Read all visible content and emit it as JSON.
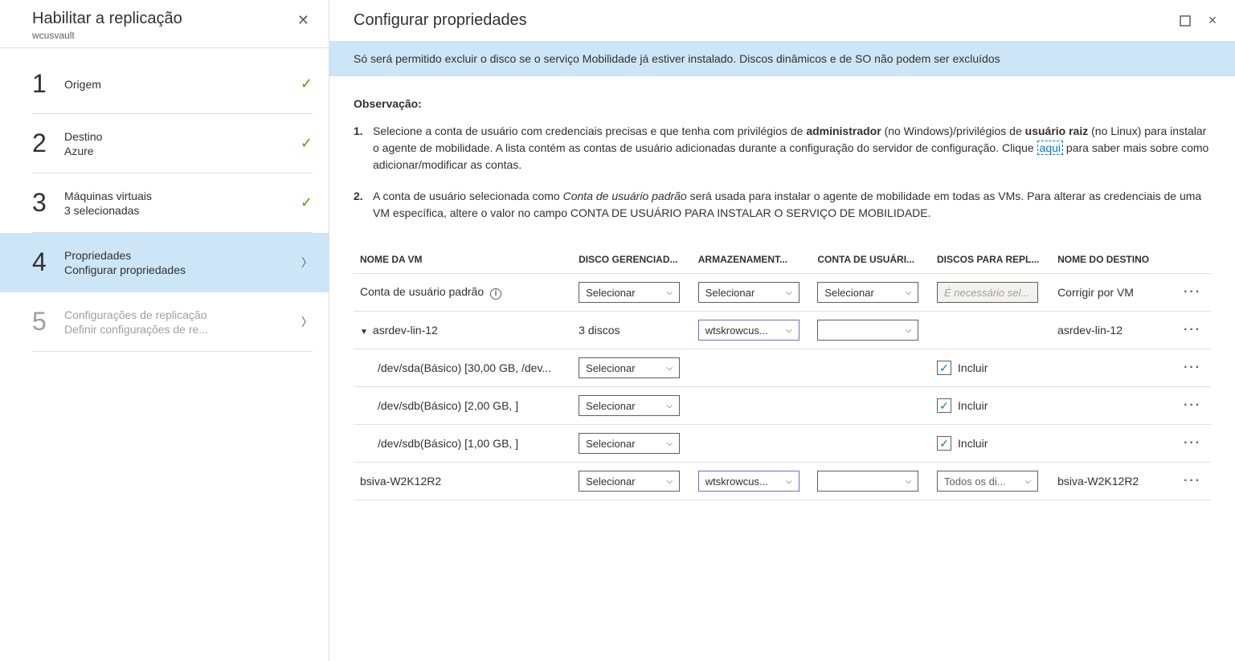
{
  "sidebar": {
    "title": "Habilitar a replicação",
    "subtitle": "wcusvault",
    "steps": [
      {
        "num": "1",
        "label": "Origem",
        "sublabel": "",
        "status": "done"
      },
      {
        "num": "2",
        "label": "Destino",
        "sublabel": "Azure",
        "status": "done"
      },
      {
        "num": "3",
        "label": "Máquinas virtuais",
        "sublabel": "3 selecionadas",
        "status": "done"
      },
      {
        "num": "4",
        "label": "Propriedades",
        "sublabel": "Configurar propriedades",
        "status": "active"
      },
      {
        "num": "5",
        "label": "Configurações de replicação",
        "sublabel": "Definir configurações de re...",
        "status": "disabled"
      }
    ]
  },
  "main": {
    "title": "Configurar propriedades",
    "banner": "Só será permitido excluir o disco se o serviço Mobilidade já estiver instalado. Discos dinâmicos e de SO não podem ser excluídos",
    "obs_heading": "Observação:",
    "obs1_a": "Selecione a conta de usuário com credenciais precisas e que tenha com privilégios de ",
    "obs1_b": "administrador",
    "obs1_c": " (no Windows)/privilégios de ",
    "obs1_d": "usuário raiz",
    "obs1_e": " (no Linux) para instalar o agente de mobilidade. A lista contém as contas de usuário adicionadas durante a configuração do servidor de configuração. Clique ",
    "obs1_link": "aqui",
    "obs1_f": " para saber mais sobre como adicionar/modificar as contas.",
    "obs2_a": "A conta de usuário selecionada como ",
    "obs2_b": "Conta de usuário padrão",
    "obs2_c": " será usada para instalar o agente de mobilidade em todas as VMs. Para alterar as credenciais de uma VM específica, altere o valor no campo CONTA DE USUÁRIO PARA INSTALAR O SERVIÇO DE MOBILIDADE.",
    "table": {
      "headers": {
        "vm": "NOME DA VM",
        "disk": "DISCO GERENCIAD...",
        "storage": "ARMAZENAMENT...",
        "account": "CONTA DE USUÁRI...",
        "repl": "DISCOS PARA REPL...",
        "dest": "NOME DO DESTINO"
      },
      "default_row": {
        "label": "Conta de usuário padrão",
        "disk_select": "Selecionar",
        "storage_select": "Selecionar",
        "account_select": "Selecionar",
        "repl_placeholder": "É necessário sel...",
        "dest": "Corrigir por VM"
      },
      "vm1": {
        "name": "asrdev-lin-12",
        "disk_count": "3 discos",
        "storage": "wtskrowcus...",
        "dest": "asrdev-lin-12",
        "disks": [
          {
            "name": "/dev/sda(Básico) [30,00 GB, /dev...",
            "select": "Selecionar",
            "incl": "Incluir"
          },
          {
            "name": "/dev/sdb(Básico) [2,00 GB, ]",
            "select": "Selecionar",
            "incl": "Incluir"
          },
          {
            "name": "/dev/sdb(Básico) [1,00 GB, ]",
            "select": "Selecionar",
            "incl": "Incluir"
          }
        ]
      },
      "vm2": {
        "name": "bsiva-W2K12R2",
        "disk_select": "Selecionar",
        "storage": "wtskrowcus...",
        "repl": "Todos os di...",
        "dest": "bsiva-W2K12R2"
      }
    }
  }
}
